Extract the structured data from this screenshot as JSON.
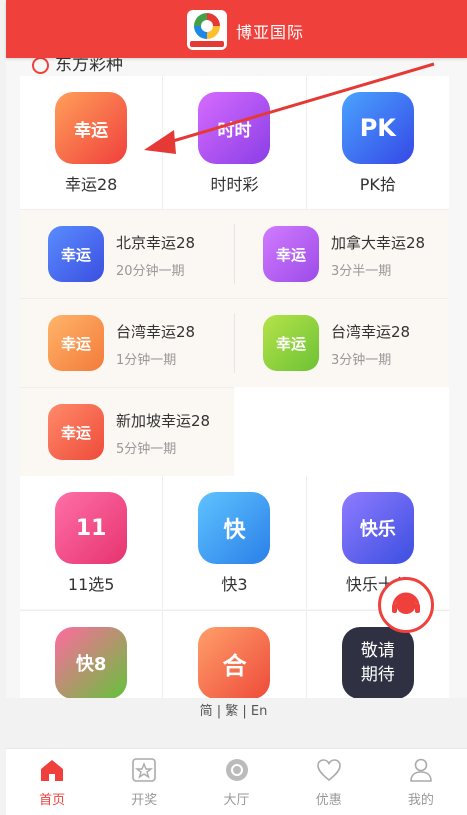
{
  "header": {
    "title": "博亚国际"
  },
  "section": {
    "title": "东方彩种"
  },
  "top_games": [
    {
      "label": "幸运28",
      "icon_text": "幸运",
      "icon": "lucky28-icon"
    },
    {
      "label": "时时彩",
      "icon_text": "时时",
      "icon": "shishicai-icon"
    },
    {
      "label": "PK拾",
      "icon_text": "PK",
      "icon": "pk10-icon"
    }
  ],
  "sub_games": [
    {
      "name": "北京幸运28",
      "desc": "20分钟一期"
    },
    {
      "name": "加拿大幸运28",
      "desc": "3分半一期"
    },
    {
      "name": "台湾幸运28",
      "desc": "1分钟一期"
    },
    {
      "name": "台湾幸运28",
      "desc": "3分钟一期"
    },
    {
      "name": "新加坡幸运28",
      "desc": "5分钟一期"
    }
  ],
  "sub_icon_text": "幸运",
  "mid_games": [
    {
      "label": "11选5",
      "icon_text": "11"
    },
    {
      "label": "快3",
      "icon_text": "快"
    },
    {
      "label": "快乐十分",
      "icon_text": "快乐"
    }
  ],
  "bottom_games": [
    {
      "icon_text": "快8"
    },
    {
      "icon_text": "合"
    },
    {
      "icon_text": "敬请期待"
    }
  ],
  "language": {
    "text": "简 | 繁 | En"
  },
  "tabs": [
    {
      "label": "首页",
      "icon": "home-icon"
    },
    {
      "label": "开奖",
      "icon": "star-icon"
    },
    {
      "label": "大厅",
      "icon": "lobby-icon"
    },
    {
      "label": "优惠",
      "icon": "heart-icon"
    },
    {
      "label": "我的",
      "icon": "user-icon"
    }
  ],
  "colors": {
    "accent": "#f0403c"
  }
}
